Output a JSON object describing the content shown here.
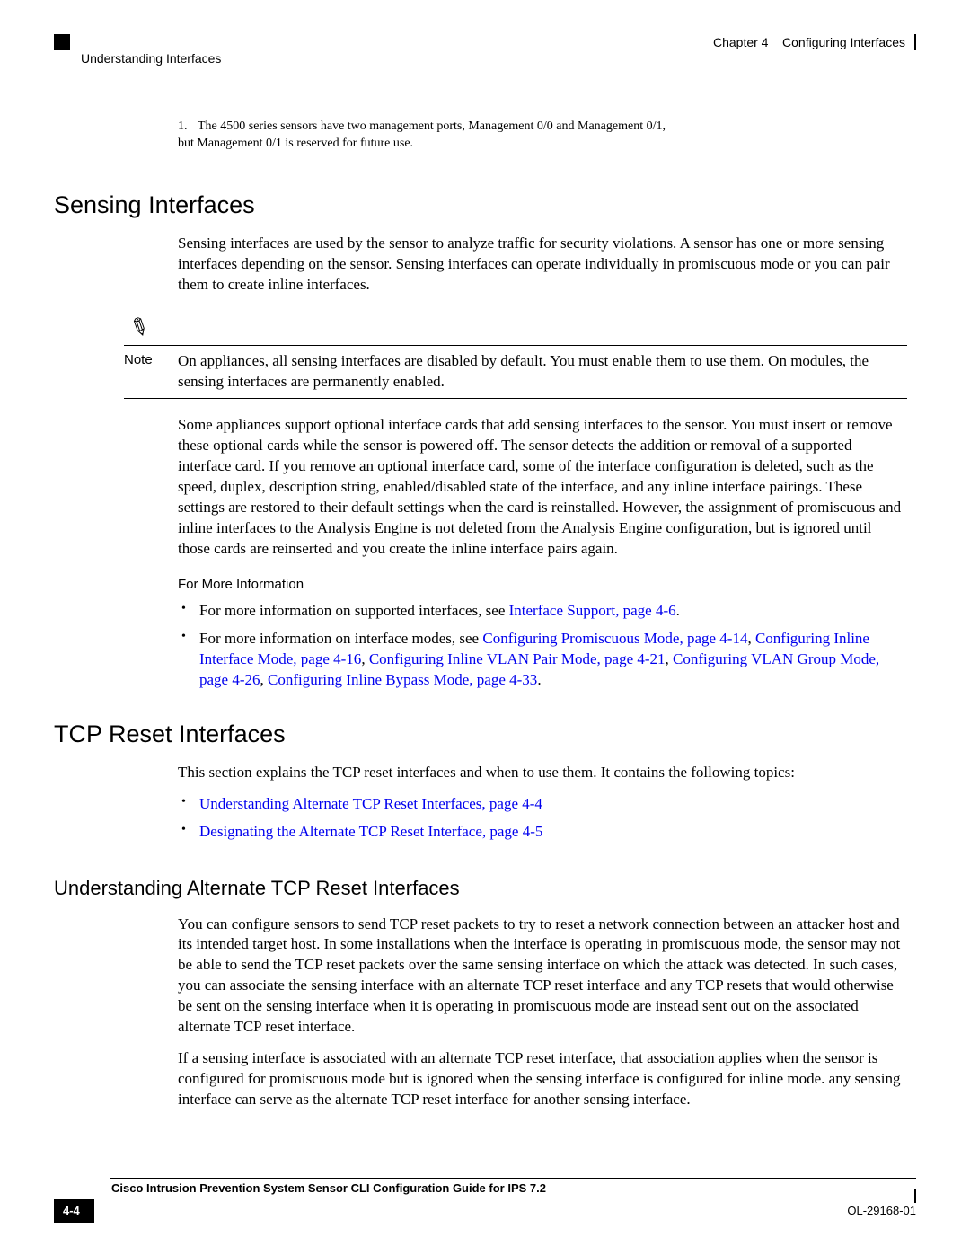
{
  "header": {
    "left": "Understanding Interfaces",
    "right_chapter": "Chapter 4",
    "right_title": "Configuring Interfaces"
  },
  "footnote": {
    "num": "1.",
    "text": "The 4500 series sensors have two management ports, Management 0/0 and Management 0/1, but Management 0/1 is reserved for future use."
  },
  "sensing": {
    "heading": "Sensing Interfaces",
    "p1": "Sensing interfaces are used by the sensor to analyze traffic for security violations. A sensor has one or more sensing interfaces depending on the sensor. Sensing interfaces can operate individually in promiscuous mode or you can pair them to create inline interfaces.",
    "note_label": "Note",
    "note_text": "On appliances, all sensing interfaces are disabled by default. You must enable them to use them. On modules, the sensing interfaces are permanently enabled.",
    "p2": "Some appliances support optional interface cards that add sensing interfaces to the sensor. You must insert or remove these optional cards while the sensor is powered off. The sensor detects the addition or removal of a supported interface card. If you remove an optional interface card, some of the interface configuration is deleted, such as the speed, duplex, description string, enabled/disabled state of the interface, and any inline interface pairings. These settings are restored to their default settings when the card is reinstalled. However, the assignment of promiscuous and inline interfaces to the Analysis Engine is not deleted from the Analysis Engine configuration, but is ignored until those cards are reinserted and you create the inline interface pairs again.",
    "fmi_heading": "For More Information",
    "fmi_b1_pre": "For more information on supported interfaces, see ",
    "fmi_b1_link": "Interface Support, page 4-6",
    "fmi_b2_pre": "For more information on interface modes, see ",
    "fmi_b2_l1": "Configuring Promiscuous Mode, page 4-14",
    "fmi_b2_l2": "Configuring Inline Interface Mode, page 4-16",
    "fmi_b2_l3": "Configuring Inline VLAN Pair Mode, page 4-21",
    "fmi_b2_l4": "Configuring VLAN Group Mode, page 4-26",
    "fmi_b2_l5": "Configuring Inline Bypass Mode, page 4-33"
  },
  "tcp": {
    "heading": "TCP Reset Interfaces",
    "intro": "This section explains the TCP reset interfaces and when to use them. It contains the following topics:",
    "topic1": "Understanding Alternate TCP Reset Interfaces, page 4-4",
    "topic2": "Designating the Alternate TCP Reset Interface, page 4-5",
    "sub_heading": "Understanding Alternate TCP Reset Interfaces",
    "p1": "You can configure sensors to send TCP reset packets to try to reset a network connection between an attacker host and its intended target host. In some installations when the interface is operating in promiscuous mode, the sensor may not be able to send the TCP reset packets over the same sensing interface on which the attack was detected. In such cases, you can associate the sensing interface with an alternate TCP reset interface and any TCP resets that would otherwise be sent on the sensing interface when it is operating in promiscuous mode are instead sent out on the associated alternate TCP reset interface.",
    "p2": "If a sensing interface is associated with an alternate TCP reset interface, that association applies when the sensor is configured for promiscuous mode but is ignored when the sensing interface is configured for inline mode. any sensing interface can serve as the alternate TCP reset interface for another sensing interface."
  },
  "footer": {
    "doc_title": "Cisco Intrusion Prevention System Sensor CLI Configuration Guide for IPS 7.2",
    "page": "4-4",
    "doc_id": "OL-29168-01"
  }
}
